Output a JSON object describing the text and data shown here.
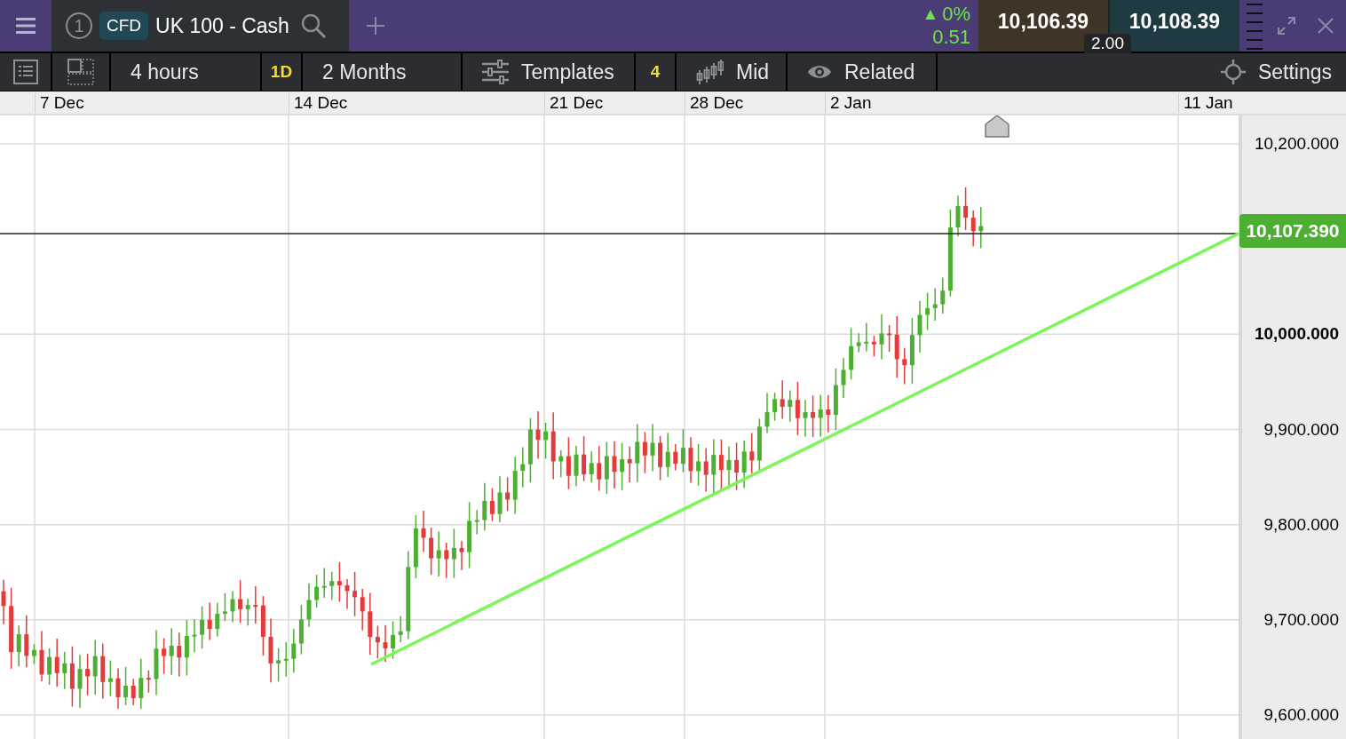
{
  "header": {
    "tab_number": "1",
    "instrument_type": "CFD",
    "instrument_name": "UK 100 - Cash",
    "change_arrow": "▲",
    "change_percent": "0%",
    "change_points": "0.51",
    "sell_price": "10,106.39",
    "buy_price": "10,108.39",
    "spread": "2.00"
  },
  "toolbar": [
    {
      "kind": "icon"
    },
    {
      "kind": "icon"
    },
    {
      "kind": "text",
      "label": "4 hours"
    },
    {
      "kind": "accent",
      "label": "1D"
    },
    {
      "kind": "text",
      "label": "2 Months"
    },
    {
      "kind": "icon_text",
      "label": "Templates"
    },
    {
      "kind": "accent",
      "label": "4"
    },
    {
      "kind": "icon_text",
      "label": "Mid"
    },
    {
      "kind": "icon_text",
      "label": "Related"
    },
    {
      "kind": "settings",
      "label": "Settings"
    }
  ],
  "date_axis": [
    "7 Dec",
    "14 Dec",
    "21 Dec",
    "28 Dec",
    "2 Jan",
    "11 Jan"
  ],
  "price_axis": [
    {
      "label": "10,200.000",
      "emphasized": false
    },
    {
      "label": "10,000.000",
      "emphasized": true
    },
    {
      "label": "9,900.000",
      "emphasized": false
    },
    {
      "label": "9,800.000",
      "emphasized": false
    },
    {
      "label": "9,700.000",
      "emphasized": false
    },
    {
      "label": "9,600.000",
      "emphasized": false
    }
  ],
  "current_price": "10,107.390"
}
